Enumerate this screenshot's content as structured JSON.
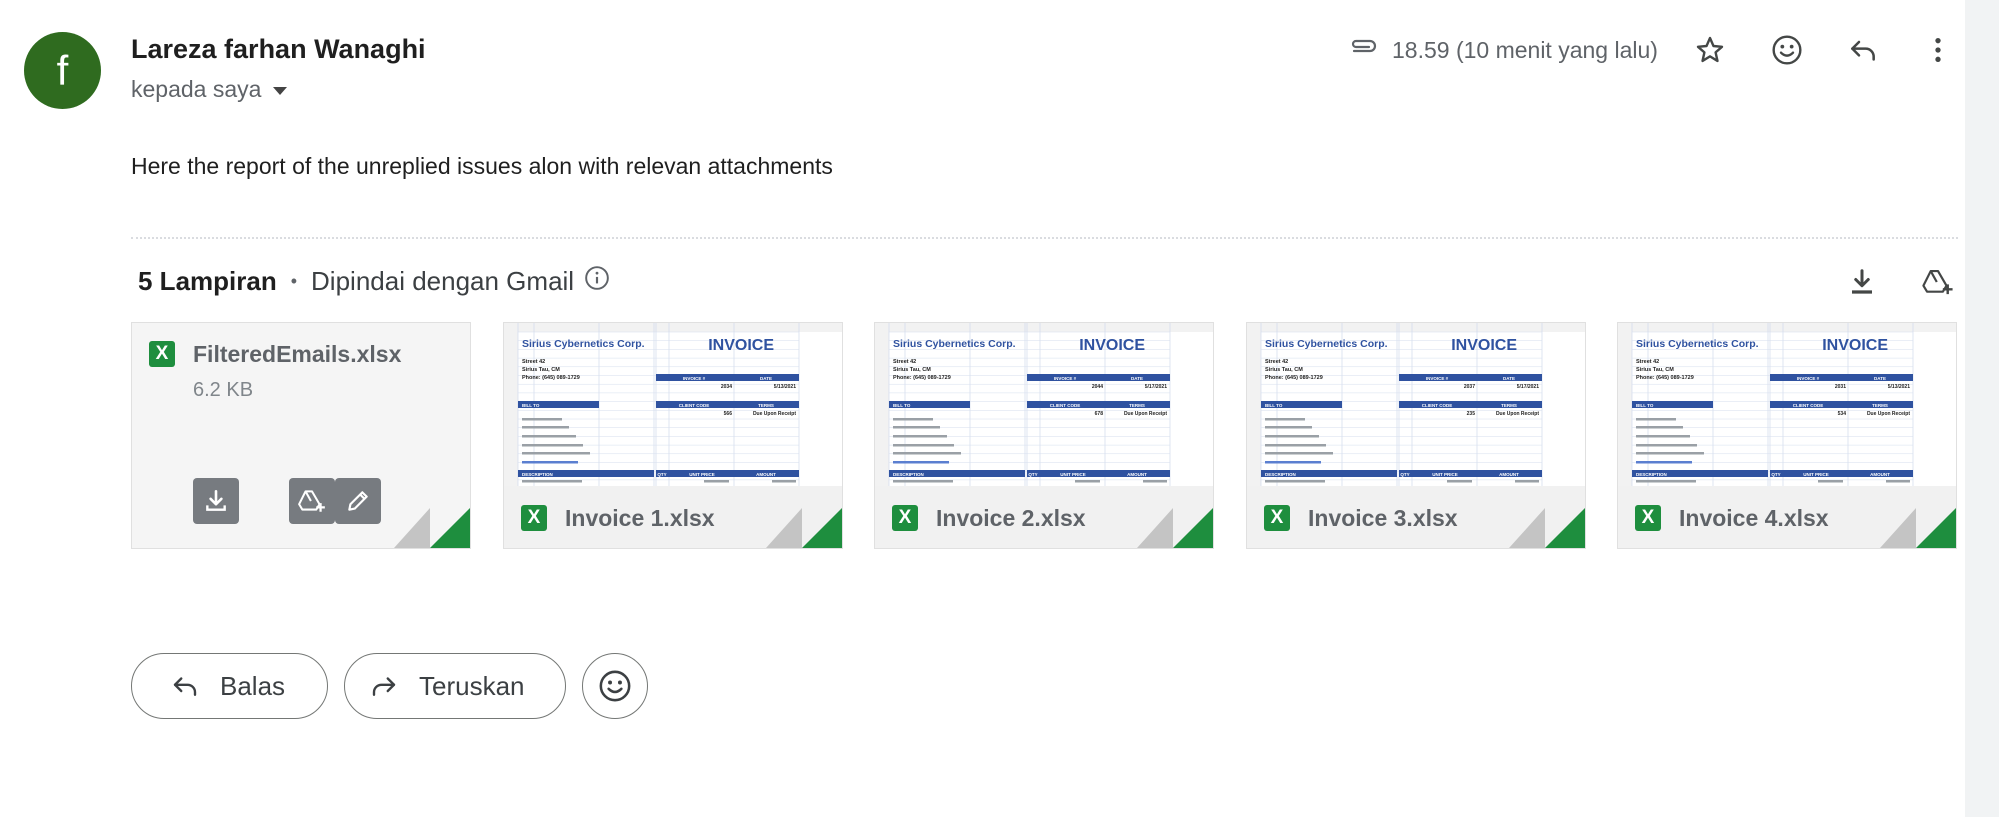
{
  "sender": {
    "avatar_letter": "f",
    "name": "Lareza farhan Wanaghi",
    "recipient_label": "kepada saya"
  },
  "header": {
    "time": "18.59 (10 menit yang lalu)"
  },
  "message": {
    "body": "Here the report of the unreplied issues alon with relevan attachments"
  },
  "attachments": {
    "count_label": "5 Lampiran",
    "separator": "•",
    "scanned_label": "Dipindai dengan Gmail",
    "files": [
      {
        "name": "FilteredEmails.xlsx",
        "size": "6.2 KB",
        "type_letter": "X"
      },
      {
        "name": "Invoice 1.xlsx",
        "type_letter": "X"
      },
      {
        "name": "Invoice 2.xlsx",
        "type_letter": "X"
      },
      {
        "name": "Invoice 3.xlsx",
        "type_letter": "X"
      },
      {
        "name": "Invoice 4.xlsx",
        "type_letter": "X"
      }
    ],
    "preview": {
      "company": "Sirius Cybernetics Corp.",
      "title": "INVOICE",
      "street": "Street 42",
      "city": "Sirius Tau, CM",
      "phone": "Phone: (645) 089-1729",
      "invoice_label": "INVOICE #",
      "date_label": "DATE",
      "billto_label": "BILL TO",
      "client_label": "CLIENT CODE",
      "terms_label": "TERMS",
      "terms_value": "Due Upon Receipt",
      "description_label": "DESCRIPTION",
      "qty_label": "QTY",
      "unit_label": "UNIT PRICE",
      "amount_label": "AMOUNT",
      "invoices": [
        {
          "invoice_no": "2034",
          "date": "5/13/2021",
          "client": "566"
        },
        {
          "invoice_no": "2044",
          "date": "5/17/2021",
          "client": "678"
        },
        {
          "invoice_no": "2037",
          "date": "5/17/2021",
          "client": "235"
        },
        {
          "invoice_no": "2031",
          "date": "5/13/2021",
          "client": "534"
        }
      ]
    }
  },
  "actions": {
    "reply": "Balas",
    "forward": "Teruskan"
  },
  "colors": {
    "avatar": "#2f6b1f",
    "excel_green": "#1e8e3e",
    "invoice_blue": "#2f52a0",
    "action_button": "#777b80"
  }
}
